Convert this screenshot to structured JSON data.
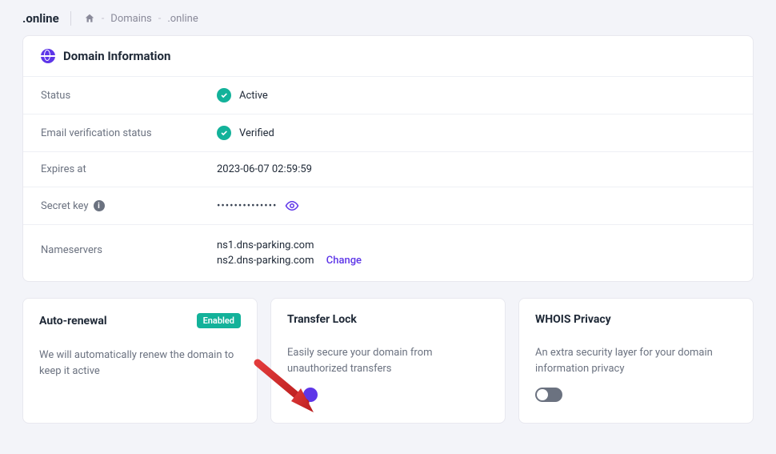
{
  "header": {
    "domain_title": ".online"
  },
  "breadcrumb": {
    "domains_label": "Domains",
    "current": ".online"
  },
  "domain_info": {
    "section_title": "Domain Information",
    "status_label": "Status",
    "status_value": "Active",
    "email_label": "Email verification status",
    "email_value": "Verified",
    "expires_label": "Expires at",
    "expires_value": "2023-06-07 02:59:59",
    "secret_label": "Secret key",
    "secret_masked": "••••••••••••••",
    "nameservers_label": "Nameservers",
    "ns1": "ns1.dns-parking.com",
    "ns2": "ns2.dns-parking.com",
    "change_label": "Change"
  },
  "cards": {
    "auto_renewal": {
      "title": "Auto-renewal",
      "badge": "Enabled",
      "desc": "We will automatically renew the domain to keep it active"
    },
    "transfer_lock": {
      "title": "Transfer Lock",
      "desc": "Easily secure your domain from unauthorized transfers"
    },
    "whois_privacy": {
      "title": "WHOIS Privacy",
      "desc": "An extra security layer for your domain information privacy"
    }
  }
}
